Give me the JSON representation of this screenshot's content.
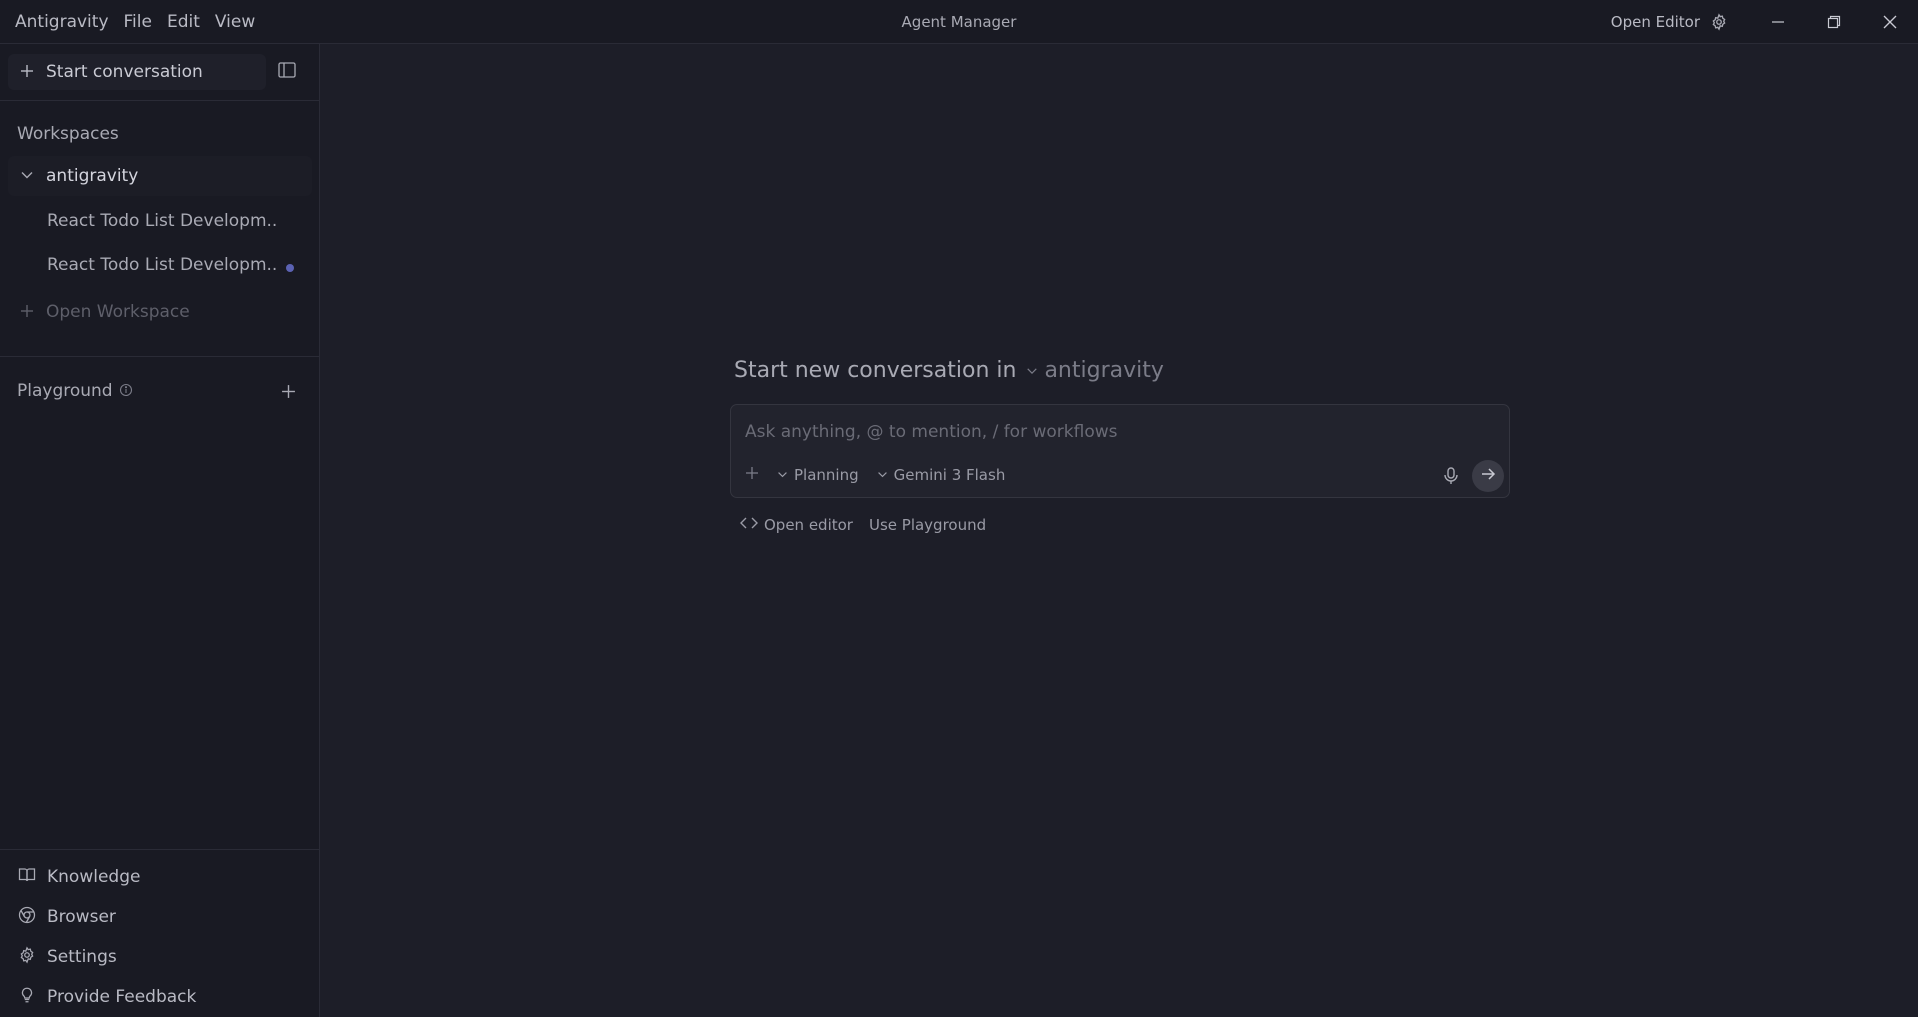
{
  "titlebar": {
    "menu": [
      "Antigravity",
      "File",
      "Edit",
      "View"
    ],
    "title": "Agent Manager",
    "open_editor": "Open Editor"
  },
  "sidebar": {
    "start_conversation": "Start conversation",
    "workspaces_label": "Workspaces",
    "workspace": {
      "name": "antigravity",
      "expanded": true,
      "conversations": [
        {
          "title": "React Todo List Developm...",
          "unread": false
        },
        {
          "title": "React Todo List Developm...",
          "unread": true
        }
      ]
    },
    "open_workspace": "Open Workspace",
    "playground_label": "Playground",
    "bottom": [
      "Knowledge",
      "Browser",
      "Settings",
      "Provide Feedback"
    ]
  },
  "main": {
    "heading": "Start new conversation in",
    "heading_workspace": "antigravity",
    "input_placeholder": "Ask anything, @ to mention, / for workflows",
    "mode": "Planning",
    "model": "Gemini 3 Flash",
    "open_editor_link": "Open editor",
    "use_playground": "Use Playground"
  },
  "colors": {
    "background": "#1d1e28",
    "sidebar": "#191a23",
    "unread_dot": "#5b62b3"
  },
  "icons": [
    "plus-icon",
    "sidebar-toggle-icon",
    "chevron-down-icon",
    "info-icon",
    "book-icon",
    "chrome-icon",
    "gear-icon",
    "lightbulb-icon",
    "mic-icon",
    "arrow-right-icon",
    "code-icon",
    "minimize-icon",
    "restore-icon",
    "close-icon"
  ]
}
